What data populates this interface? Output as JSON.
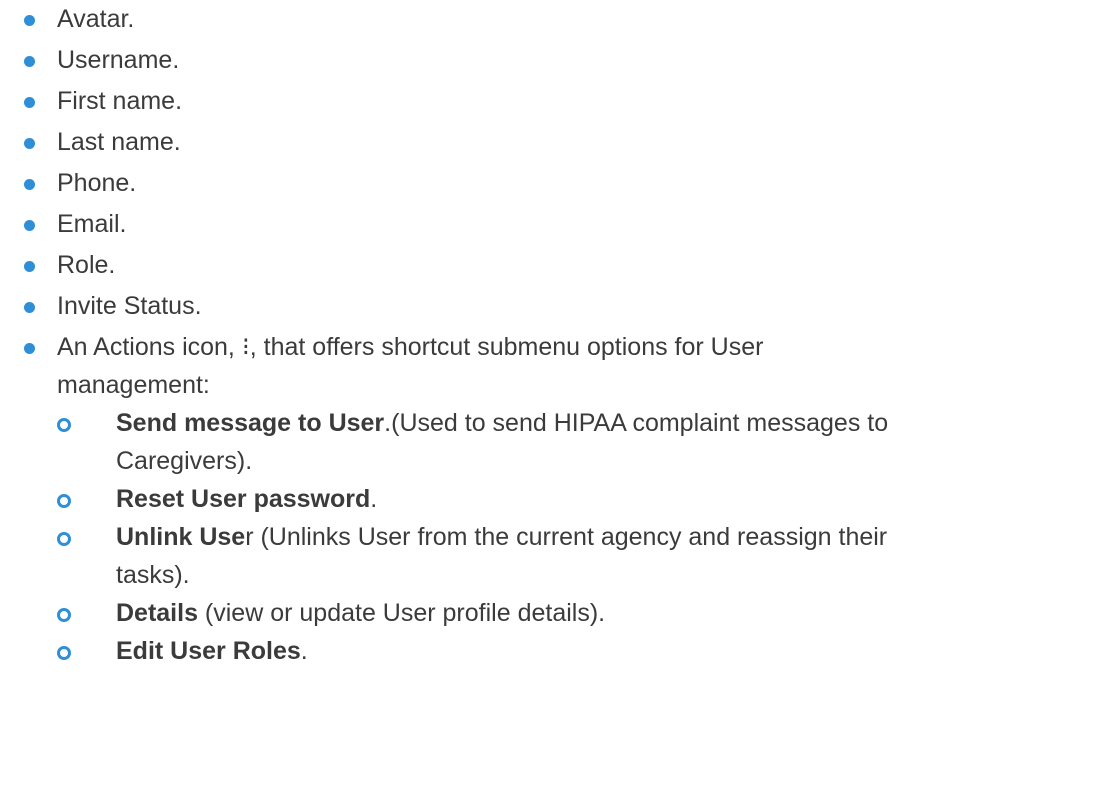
{
  "bullet_color": "#2e8fd6",
  "items": [
    {
      "label": "Avatar."
    },
    {
      "label": "Username."
    },
    {
      "label": "First name."
    },
    {
      "label": "Last name."
    },
    {
      "label": "Phone."
    },
    {
      "label": "Email."
    },
    {
      "label": "Role."
    },
    {
      "label": "Invite Status."
    }
  ],
  "actions": {
    "intro_line1": "An Actions icon, ⁝, that offers shortcut submenu options for User",
    "intro_line2": "management:",
    "sub_items": [
      {
        "bold": "Send message to User",
        "rest_line1": ".(Used to send HIPAA complaint messages to",
        "rest_line2": "Caregivers)."
      },
      {
        "bold": "Reset User password",
        "rest_line1": ".",
        "rest_line2": ""
      },
      {
        "bold": "Unlink Use",
        "rest_line1": "r (Unlinks User from the current agency and reassign their",
        "rest_line2": "tasks)."
      },
      {
        "bold": "Details",
        "rest_line1": " (view or update User profile details).",
        "rest_line2": ""
      },
      {
        "bold": "Edit User Roles",
        "rest_line1": ".",
        "rest_line2": ""
      }
    ]
  }
}
